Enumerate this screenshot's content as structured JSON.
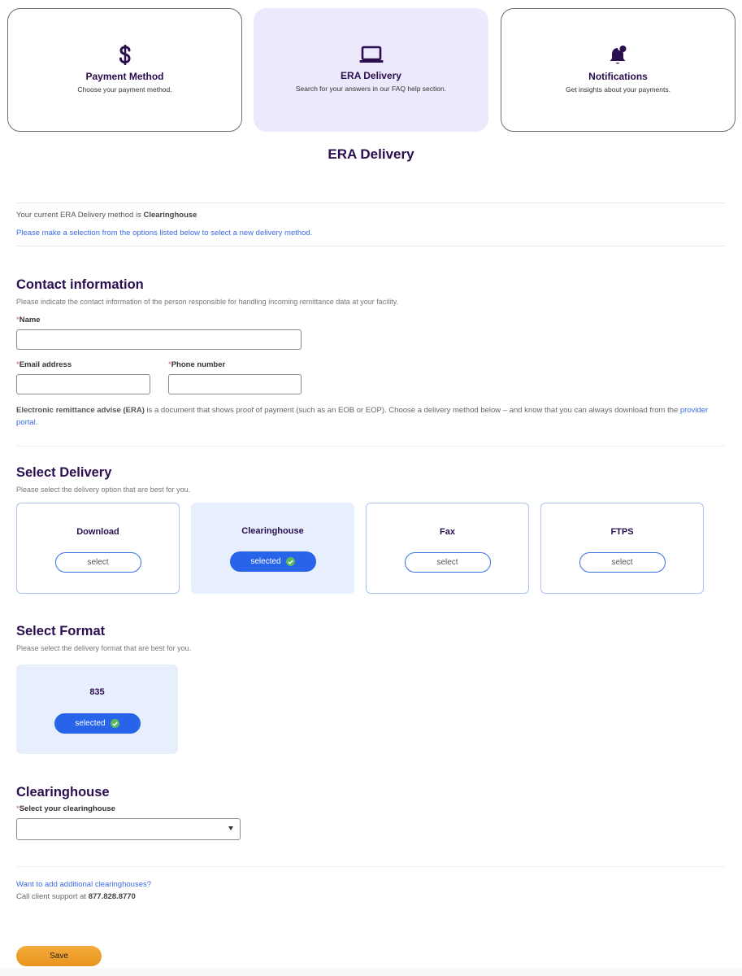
{
  "top_nav": {
    "cards": [
      {
        "icon": "dollar-icon",
        "title": "Payment Method",
        "description": "Choose your payment method.",
        "active": false
      },
      {
        "icon": "laptop-icon",
        "title": "ERA Delivery",
        "description": "Search for your answers in our FAQ help section.",
        "active": true
      },
      {
        "icon": "bell-icon",
        "title": "Notifications",
        "description": "Get insights about your payments.",
        "active": false
      }
    ]
  },
  "page": {
    "title": "ERA Delivery",
    "current_method_prefix": "Your current ERA Delivery method is ",
    "current_method_value": "Clearinghouse",
    "selection_prompt": "Please make a selection from the options listed below to select a new delivery method."
  },
  "contact": {
    "title": "Contact information",
    "subtitle": "Please indicate the contact information of the person responsible for handling incoming remittance data at your facility.",
    "required_marker": "*",
    "name_label": "Name",
    "name_value": "",
    "email_label": "Email address",
    "email_value": "",
    "phone_label": "Phone number",
    "phone_value": ""
  },
  "era_note": {
    "bold_term": "Electronic remittance advise (ERA)",
    "text": " is a document that shows proof of payment (such as an EOB or EOP). Choose a delivery method below – and know that you can always download from the ",
    "link": "provider portal",
    "end": "."
  },
  "delivery": {
    "title": "Select Delivery",
    "subtitle": "Please select the delivery option that are best for you.",
    "options": [
      {
        "label": "Download",
        "button": "select",
        "selected": false
      },
      {
        "label": "Clearinghouse",
        "button": "selected",
        "selected": true
      },
      {
        "label": "Fax",
        "button": "select",
        "selected": false
      },
      {
        "label": "FTPS",
        "button": "select",
        "selected": false
      }
    ]
  },
  "format": {
    "title": "Select Format",
    "subtitle": "Please select the delivery format that are best for you.",
    "options": [
      {
        "label": "835",
        "button": "selected",
        "selected": true
      }
    ]
  },
  "clearinghouse": {
    "title": "Clearinghouse",
    "required_marker": "*",
    "select_label": "Select your clearinghouse",
    "selected_value": ""
  },
  "support": {
    "add_link": "Want to add additional clearinghouses?",
    "call_prefix": "Call client support at ",
    "phone": "877.828.8770"
  },
  "actions": {
    "save_label": "Save"
  },
  "colors": {
    "brand_dark": "#2a0e4f",
    "link_blue": "#3b6be6",
    "selected_blue": "#2864ea",
    "save_orange": "#f0a030",
    "active_card_bg": "#ece9fc",
    "success_green": "#5cb85c"
  }
}
